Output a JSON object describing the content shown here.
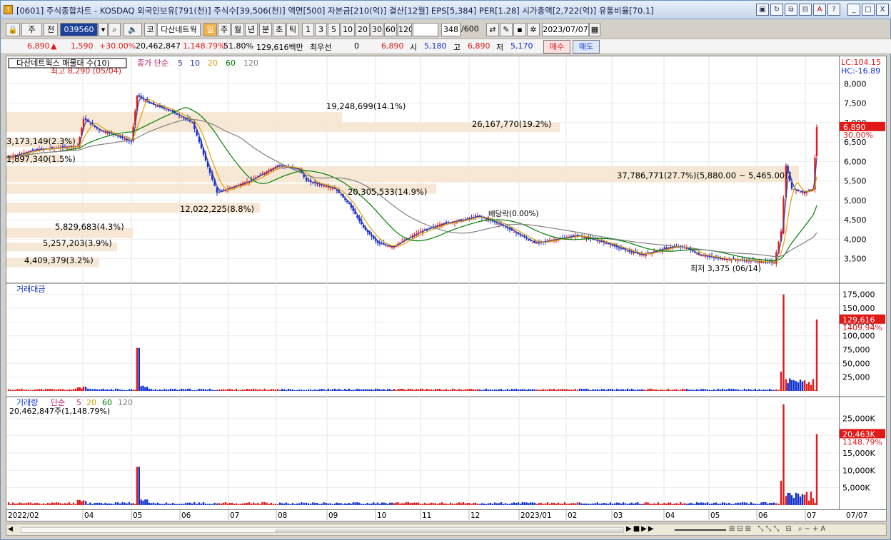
{
  "title": "[0601] 주식종합차트 - KOSDAQ 외국인보유[791(천)] 주식수[39,506(천)] 액면[500] 자본금[210(억)] 결산[12월] EPS[5,384] PER[1.28] 시가총액[2,722(억)] 유통비율[70.1]",
  "title_buttons": [
    "▣",
    "↻",
    "⧉",
    "⊟",
    "A",
    "?",
    "_",
    "□",
    "X"
  ],
  "toolbar": {
    "type": "주",
    "scope": "전",
    "code": "039560",
    "gubun": "코",
    "name": "다산네트웍",
    "periods": [
      "일",
      "주",
      "월",
      "년",
      "분",
      "초",
      "틱"
    ],
    "selected_period": "일",
    "nums": [
      "1",
      "3",
      "5",
      "10",
      "20",
      "30",
      "60",
      "120"
    ],
    "count": "348",
    "count_total": "/600",
    "date": "2023/07/07"
  },
  "quote": {
    "price": "6,890",
    "arrow": "▲",
    "change": "1,590",
    "rate": "+30.00%",
    "volume": "20,462,847",
    "vol_rate": "1,148.79%",
    "pct2": "51.80%",
    "amount": "129,616백만",
    "choi": "최우선",
    "choi_val": "0",
    "bid": "6,890",
    "open_label": "시",
    "open": "5,180",
    "high_label": "고",
    "high": "6,890",
    "low_label": "저",
    "low": "5,170",
    "buy": "매수",
    "sell": "매도"
  },
  "price_panel": {
    "title": "다산네트윅스 매물대 수(10)",
    "ma_label": "종가 단순",
    "ma": [
      "5",
      "10",
      "20",
      "60",
      "120"
    ],
    "high_note": "최고 8,290 (05/04)",
    "low_note": "최저 3,375 (06/14)",
    "down_note": "배당락(0.00%)",
    "lc": "LC:104.15",
    "hc": "HC:-16.89",
    "volume_profile": [
      "19,248,699(14.1%)",
      "26,167,770(19.2%)",
      "3,173,149(2.3%)",
      "1,897,340(1.5%)",
      "37,786,771(27.7%)(5,880.00 ~ 5,465.00)",
      "20,305,533(14.9%)",
      "12,022,225(8.8%)",
      "5,829,683(4.3%)",
      "5,257,203(3.9%)",
      "4,409,379(3.2%)"
    ],
    "y_ticks": [
      "8,000",
      "7,500",
      "7,000",
      "6,500",
      "6,000",
      "5,500",
      "5,000",
      "4,500",
      "4,000",
      "3,500"
    ],
    "last_price": "6,890",
    "last_pct": "30.00%"
  },
  "amount_panel": {
    "title": "거래대금",
    "y_ticks": [
      "175,000",
      "150,000",
      "125,000",
      "100,000",
      "75,000",
      "50,000",
      "25,000"
    ],
    "last": "129,616",
    "last_pct": "1409.94%"
  },
  "volume_panel": {
    "title": "거래량",
    "ma_label": "단순",
    "ma": [
      "5",
      "20",
      "60",
      "120"
    ],
    "sub": "20,462,847주(1,148.79%)",
    "y_ticks": [
      "25,000K",
      "20,000K",
      "15,000K",
      "10,000K",
      "5,000K"
    ],
    "last": "20,463K",
    "last_pct": "1148.79%"
  },
  "x_ticks": [
    "2022/02",
    "04",
    "05",
    "06",
    "07",
    "08",
    "09",
    "10",
    "11",
    "12",
    "2023/01",
    "02",
    "03",
    "04",
    "05",
    "06",
    "07"
  ],
  "x_end": "07/07",
  "colors": {
    "up": "#e01818",
    "down": "#1030d0",
    "ma5": "#4040a0",
    "ma20": "#e0a000",
    "ma60": "#008000",
    "ma120": "#808080",
    "vp": "#f5e6cf"
  },
  "bottom_icons": [
    "prev-icon",
    "play-icon",
    "stop-icon",
    "next-icon",
    "zoom-out-icon",
    "zoom-in-icon",
    "a-icon"
  ]
}
